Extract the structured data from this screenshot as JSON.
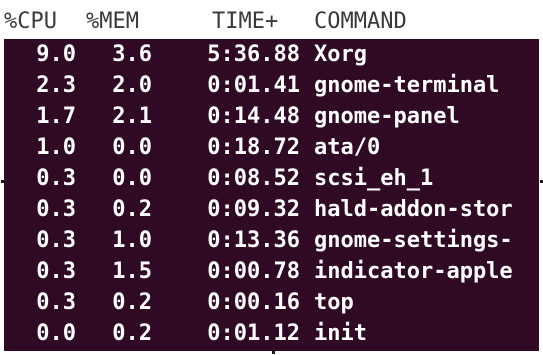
{
  "header": {
    "cpu": "%CPU",
    "mem": "%MEM",
    "time": "TIME+",
    "command": "COMMAND"
  },
  "processes": [
    {
      "cpu": "9.0",
      "mem": "3.6",
      "time": "5:36.88",
      "command": "Xorg"
    },
    {
      "cpu": "2.3",
      "mem": "2.0",
      "time": "0:01.41",
      "command": "gnome-terminal"
    },
    {
      "cpu": "1.7",
      "mem": "2.1",
      "time": "0:14.48",
      "command": "gnome-panel"
    },
    {
      "cpu": "1.0",
      "mem": "0.0",
      "time": "0:18.72",
      "command": "ata/0"
    },
    {
      "cpu": "0.3",
      "mem": "0.0",
      "time": "0:08.52",
      "command": "scsi_eh_1"
    },
    {
      "cpu": "0.3",
      "mem": "0.2",
      "time": "0:09.32",
      "command": "hald-addon-stor"
    },
    {
      "cpu": "0.3",
      "mem": "1.0",
      "time": "0:13.36",
      "command": "gnome-settings-"
    },
    {
      "cpu": "0.3",
      "mem": "1.5",
      "time": "0:00.78",
      "command": "indicator-apple"
    },
    {
      "cpu": "0.3",
      "mem": "0.2",
      "time": "0:00.16",
      "command": "top"
    },
    {
      "cpu": "0.0",
      "mem": "0.2",
      "time": "0:01.12",
      "command": "init"
    }
  ],
  "colors": {
    "terminal_background": "#300a24",
    "text": "#ffffff",
    "header_background": "#ffffff",
    "header_text": "#3a3a3a"
  }
}
